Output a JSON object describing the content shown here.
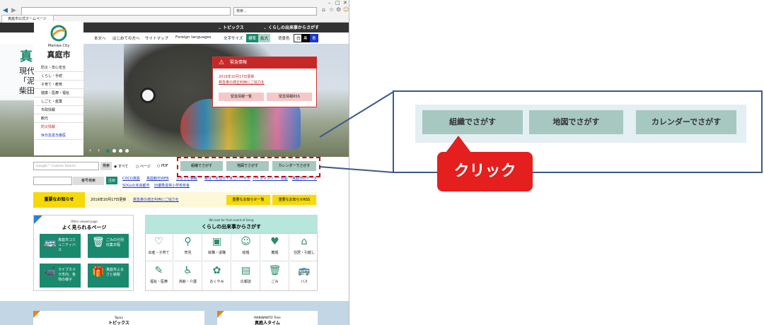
{
  "browser": {
    "tab_title": "真庭市公式ホームページ",
    "search_placeholder": "検索..."
  },
  "topnav": {
    "topics": "トピックス",
    "events": "くらしの出来事からさがす"
  },
  "header": {
    "links": [
      "本文へ",
      "はじめての方へ",
      "サイトマップ",
      "Foreign languages"
    ],
    "font_size_label": "文字サイズ",
    "font_standard": "標準",
    "font_large": "拡大",
    "color_label": "背景色",
    "color_white": "白",
    "color_black": "黒",
    "color_blue": "青"
  },
  "logo": {
    "en": "Maniwa City",
    "ja": "真庭市"
  },
  "hero": {
    "title_partial": "真",
    "text_lines": [
      "現代",
      "「泥",
      "柴田"
    ]
  },
  "side_menu": [
    "防災・安心安全",
    "くらし・手続",
    "子育て・教育",
    "健康・医療・福祉",
    "しごと・産業",
    "市政情報",
    "観光",
    "防災情報",
    "休日急患当番医"
  ],
  "emergency": {
    "title": "緊急情報",
    "date": "2019年10月17日更新",
    "link": "救急車の適正利用にご協力を",
    "btn_list": "緊急情報一覧",
    "btn_rss": "緊急情報RSS"
  },
  "search": {
    "placeholder": "Google™ Custom Search",
    "button": "検索",
    "radio_all": "すべて",
    "radio_page": "ページ",
    "radio_pdf": "PDF",
    "number_button": "番号検索"
  },
  "find_buttons": {
    "org": "組織でさがす",
    "map": "地図でさがす",
    "calendar": "カレンダーでさがす"
  },
  "attention": {
    "label": "注目",
    "links": [
      "COCO真庭",
      "真庭観光WEB",
      "ふるさと納税",
      "移住・定住ガイド",
      "ユニバーサル",
      "バイオマスツアー真庭",
      "真庭市のデータ",
      "SDGsまちかど",
      "鳥取・岡山移住"
    ],
    "links_line2": [
      "SDGsの未来都市",
      "旧遷喬尋常小学校校舎"
    ]
  },
  "notice": {
    "label": "重要なお知らせ",
    "date": "2019年10月17日更新",
    "link": "救急車の適正利用にご協力を",
    "btn_list": "重要なお知らせ一覧",
    "btn_rss": "重要なお知らせRSS"
  },
  "popular": {
    "en": "Often viewed page",
    "ja": "よく見られるページ",
    "tiles": [
      {
        "label": "真庭市コミュニティバス",
        "icon": "bus-icon"
      },
      {
        "label": "ごみの分別収集日程",
        "icon": "trash-icon"
      },
      {
        "label": "ライブカメラ市内、各地の様子",
        "icon": "camera-icon"
      },
      {
        "label": "真庭市ふるさと納税",
        "icon": "gift-icon"
      }
    ]
  },
  "life_events": {
    "en": "We look for from event of living",
    "ja": "くらしの出来事からさがす",
    "items": [
      "出産・子育て",
      "育児",
      "就職・退職",
      "結婚",
      "離婚",
      "住居・引越し",
      "福祉・医療",
      "高齢・介護",
      "おくやみ",
      "広報誌",
      "ごみ",
      "バス"
    ]
  },
  "bottom": {
    "topics_en": "Topics",
    "topics_ja": "トピックス",
    "time_en": "MANIWABITO Time",
    "time_ja": "真庭人タイム"
  },
  "callout": {
    "buttons": [
      "組織でさがす",
      "地図でさがす",
      "カレンダーでさがす"
    ],
    "click_label": "クリック"
  },
  "colors": {
    "accent_teal": "#1a8a6e",
    "highlight_red": "#e51e1e",
    "frame_blue": "#3b5a86"
  }
}
